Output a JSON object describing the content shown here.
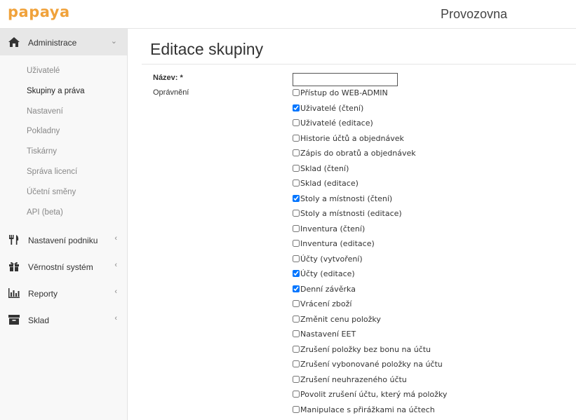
{
  "header": {
    "logo_text": "papaya",
    "title": "Provozovna"
  },
  "sidebar": {
    "active_group": {
      "label": "Administrace",
      "icon": "home-icon",
      "items": [
        {
          "label": "Uživatelé",
          "current": false
        },
        {
          "label": "Skupiny a práva",
          "current": true
        },
        {
          "label": "Nastavení",
          "current": false
        },
        {
          "label": "Pokladny",
          "current": false
        },
        {
          "label": "Tiskárny",
          "current": false
        },
        {
          "label": "Správa licencí",
          "current": false
        },
        {
          "label": "Účetní směny",
          "current": false
        },
        {
          "label": "API (beta)",
          "current": false
        }
      ]
    },
    "groups": [
      {
        "label": "Nastavení podniku",
        "icon": "restaurant-icon"
      },
      {
        "label": "Věrnostní systém",
        "icon": "gift-icon"
      },
      {
        "label": "Reporty",
        "icon": "bar-chart-icon"
      },
      {
        "label": "Sklad",
        "icon": "archive-icon"
      }
    ],
    "chevron_open": "⌄",
    "chevron_closed": "‹"
  },
  "form": {
    "page_title": "Editace skupiny",
    "name_label": "Název: *",
    "name_value": "",
    "permissions_label": "Oprávnění",
    "permissions": [
      {
        "label": "Přístup do WEB-ADMIN",
        "checked": false
      },
      {
        "label": "Uživatelé (čtení)",
        "checked": true
      },
      {
        "label": "Uživatelé (editace)",
        "checked": false
      },
      {
        "label": "Historie účtů a objednávek",
        "checked": false
      },
      {
        "label": "Zápis do obratů a objednávek",
        "checked": false
      },
      {
        "label": "Sklad (čtení)",
        "checked": false
      },
      {
        "label": "Sklad (editace)",
        "checked": false
      },
      {
        "label": "Stoly a místnosti (čtení)",
        "checked": true
      },
      {
        "label": "Stoly a místnosti (editace)",
        "checked": false
      },
      {
        "label": "Inventura (čtení)",
        "checked": false
      },
      {
        "label": "Inventura (editace)",
        "checked": false
      },
      {
        "label": "Účty (vytvoření)",
        "checked": false
      },
      {
        "label": "Účty (editace)",
        "checked": true
      },
      {
        "label": "Denní závěrka",
        "checked": true
      },
      {
        "label": "Vrácení zboží",
        "checked": false
      },
      {
        "label": "Změnit cenu položky",
        "checked": false
      },
      {
        "label": "Nastavení EET",
        "checked": false
      },
      {
        "label": "Zrušení položky bez bonu na účtu",
        "checked": false
      },
      {
        "label": "Zrušení vybonované položky na účtu",
        "checked": false
      },
      {
        "label": "Zrušení neuhrazeného účtu",
        "checked": false
      },
      {
        "label": "Povolit zrušení účtu, který má položky",
        "checked": false
      },
      {
        "label": "Manipulace s přirážkami na účtech",
        "checked": false
      }
    ]
  },
  "colors": {
    "brand": "#f0a23b",
    "sidebar_bg": "#f8f8f8",
    "active_group_bg": "#e7e7e7"
  }
}
